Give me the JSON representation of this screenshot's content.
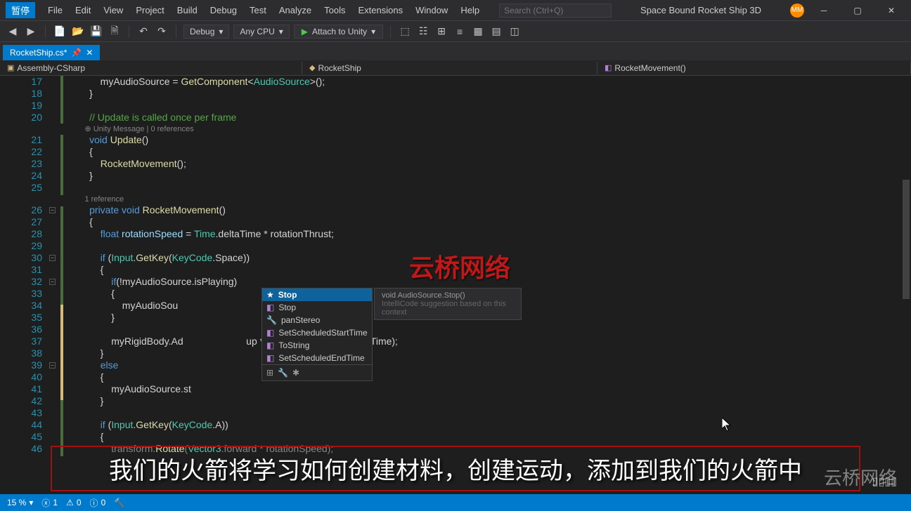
{
  "titlebar": {
    "badge": "暂停",
    "menus": [
      "File",
      "Edit",
      "View",
      "Project",
      "Build",
      "Debug",
      "Test",
      "Analyze",
      "Tools",
      "Extensions",
      "Window",
      "Help"
    ],
    "search_placeholder": "Search (Ctrl+Q)",
    "app_title": "Space Bound Rocket Ship 3D",
    "avatar": "MM"
  },
  "toolbar": {
    "config": "Debug",
    "platform": "Any CPU",
    "attach": "Attach to Unity"
  },
  "tab": {
    "filename": "RocketShip.cs*"
  },
  "breadcrumb": {
    "project": "Assembly-CSharp",
    "class": "RocketShip",
    "method": "RocketMovement()"
  },
  "code": {
    "lines": [
      17,
      18,
      19,
      20,
      21,
      22,
      23,
      24,
      25,
      26,
      27,
      28,
      29,
      30,
      31,
      32,
      33,
      34,
      35,
      36,
      37,
      38,
      39,
      40,
      41,
      42,
      43,
      44,
      45,
      46
    ],
    "l17": "            myAudioSource = GetComponent<AudioSource>();",
    "l18": "        }",
    "l19": "",
    "l20c": "        // Update is called once per frame",
    "ann1": "Unity Message | 0 references",
    "l21a": "void",
    "l21b": "Update",
    "l21c": "()",
    "l22": "        {",
    "l23a": "RocketMovement",
    "l23b": "();",
    "l24": "        }",
    "l25": "",
    "ann2": "1 reference",
    "l26a": "private",
    "l26b": "void",
    "l26c": "RocketMovement",
    "l26d": "()",
    "l27": "        {",
    "l28a": "float",
    "l28b": "rotationSpeed",
    "l28c": " = ",
    "l28d": "Time",
    "l28e": ".deltaTime * rotationThrust;",
    "l29": "",
    "l30a": "if",
    "l30b": " (",
    "l30c": "Input",
    "l30d": ".",
    "l30e": "GetKey",
    "l30f": "(",
    "l30g": "KeyCode",
    "l30h": ".Space))",
    "l31": "            {",
    "l32a": "if",
    "l32b": "(!myAudioSource.isPlaying)",
    "l33": "                {",
    "l34": "                    myAudioSou",
    "l35": "                }",
    "l36": "",
    "l37a": "                myRigidBody.Ad",
    "l37b": "up * mainThrust * ",
    "l37c": "Time",
    "l37d": ".deltaTime);",
    "l38": "            }",
    "l39a": "else",
    "l40": "            {",
    "l41": "                myAudioSource.st",
    "l42": "            }",
    "l43": "",
    "l44a": "if",
    "l44b": " (",
    "l44c": "Input",
    "l44d": ".",
    "l44e": "GetKey",
    "l44f": "(",
    "l44g": "KeyCode",
    "l44h": ".A))",
    "l45": "            {",
    "l46a": "                transform.",
    "l46b": "Rotate",
    "l46c": "(",
    "l46d": "Vector3",
    "l46e": ".forward * rotationSpeed);"
  },
  "intellisense": {
    "items": [
      {
        "label": "Stop",
        "star": true
      },
      {
        "label": "Stop"
      },
      {
        "label": "panStereo"
      },
      {
        "label": "SetScheduledStartTime"
      },
      {
        "label": "ToString"
      },
      {
        "label": "SetScheduledEndTime"
      }
    ],
    "hint_title": "void AudioSource.Stop()",
    "hint_sub": "IntelliCode suggestion based on this context"
  },
  "watermark": "云桥网络",
  "subtitle": "我们的火箭将学习如何创建材料，创建运动，添加到我们的火箭中",
  "statusbar": {
    "zoom": "15 %",
    "errors": "1",
    "warnings": "0",
    "info": "0"
  },
  "bili": "bilibili",
  "brand_wm": "云桥网络"
}
